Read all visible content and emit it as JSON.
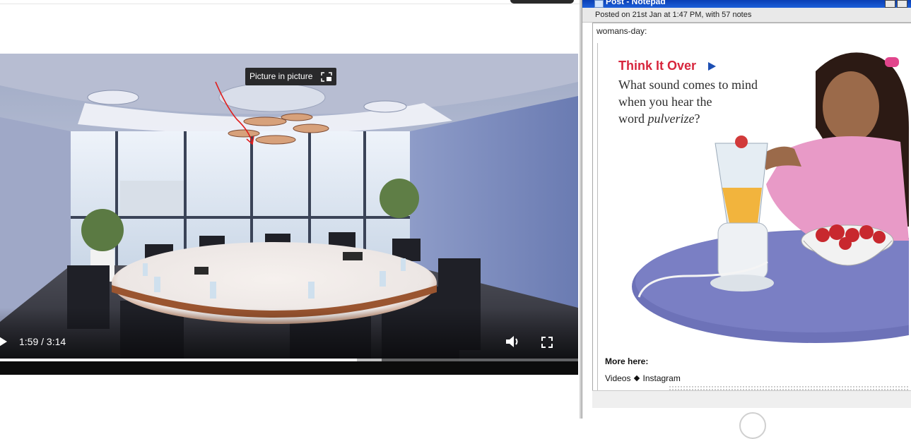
{
  "video_player": {
    "time_display": "1:59 / 3:14",
    "progress_fraction": 0.617,
    "buffer_fraction": 0.66,
    "tooltip": "Picture in picture",
    "icons": [
      "play-icon",
      "volume-icon",
      "fullscreen-icon",
      "picture-in-picture-icon"
    ]
  },
  "notepad": {
    "title": "Post - Notepad",
    "meta": "Posted on 21st Jan at 1:47 PM, with 57 notes",
    "blog_name": "womans-day:",
    "image_text": {
      "heading": "Think It Over",
      "question_line1": "What sound comes to mind",
      "question_line2": "when you hear the",
      "question_prefix": "word ",
      "question_word": "pulverize",
      "question_suffix": "?"
    },
    "more_label": "More here:",
    "links": [
      "Videos",
      "Instagram"
    ]
  },
  "colors": {
    "heading_red": "#d7263d",
    "arrow_blue": "#1d4fb3",
    "annotation_red": "#e01e1e"
  }
}
